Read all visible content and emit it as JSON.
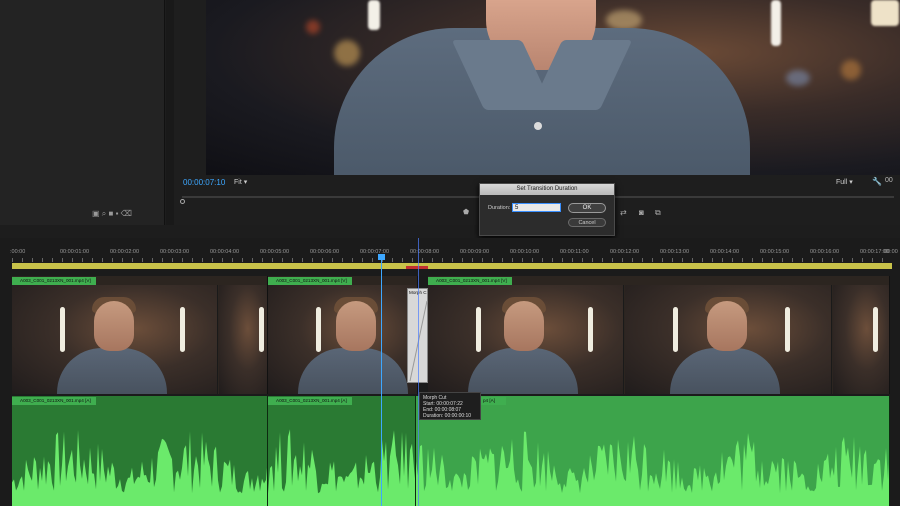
{
  "monitor": {
    "timecode": "00:00:07:10",
    "fit": "Fit",
    "full": "Full"
  },
  "dialog": {
    "title": "Set Transition Duration",
    "duration_label": "Duration:",
    "duration_value": "5",
    "ok": "OK",
    "cancel": "Cancel"
  },
  "ruler": {
    "ticks": [
      ":00:00",
      "00:00:01:00",
      "00:00:02:00",
      "00:00:03:00",
      "00:00:04:00",
      "00:00:05:00",
      "00:00:06:00",
      "00:00:07:00",
      "00:00:08:00",
      "00:00:09:00",
      "00:00:10:00",
      "00:00:11:00",
      "00:00:12:00",
      "00:00:13:00",
      "00:00:14:00",
      "00:00:15:00",
      "00:00:16:00",
      "00:00:17:00",
      "00:00"
    ]
  },
  "video_clips": [
    {
      "label": "A003_C001_0213XN_001.mp4 [V]"
    },
    {
      "label": "A003_C001_0213XN_001.mp4 [V]"
    },
    {
      "label": "A003_C001_0213XN_001.mp4 [V]"
    }
  ],
  "audio_clips": [
    {
      "label": "A003_C001_0213XN_001.mp4 [A]"
    },
    {
      "label": "A003_C001_0213XN_001.mp4 [A]"
    },
    {
      "label": "p4 [A]"
    }
  ],
  "transition": {
    "label": "Morph C"
  },
  "tooltip": {
    "title": "Morph Cut",
    "start": "Start: 00:00:07:22",
    "end": "End: 00:00:08:07",
    "duration": "Duration: 00:00:00:10"
  },
  "colors": {
    "accent_blue": "#3da7ff",
    "video_label_green": "#3fae4f",
    "audio_green": "#3da44b",
    "audio_dark_green": "#2a7a33",
    "waveform": "#6bea6b",
    "work_area": "#c8c24a"
  }
}
